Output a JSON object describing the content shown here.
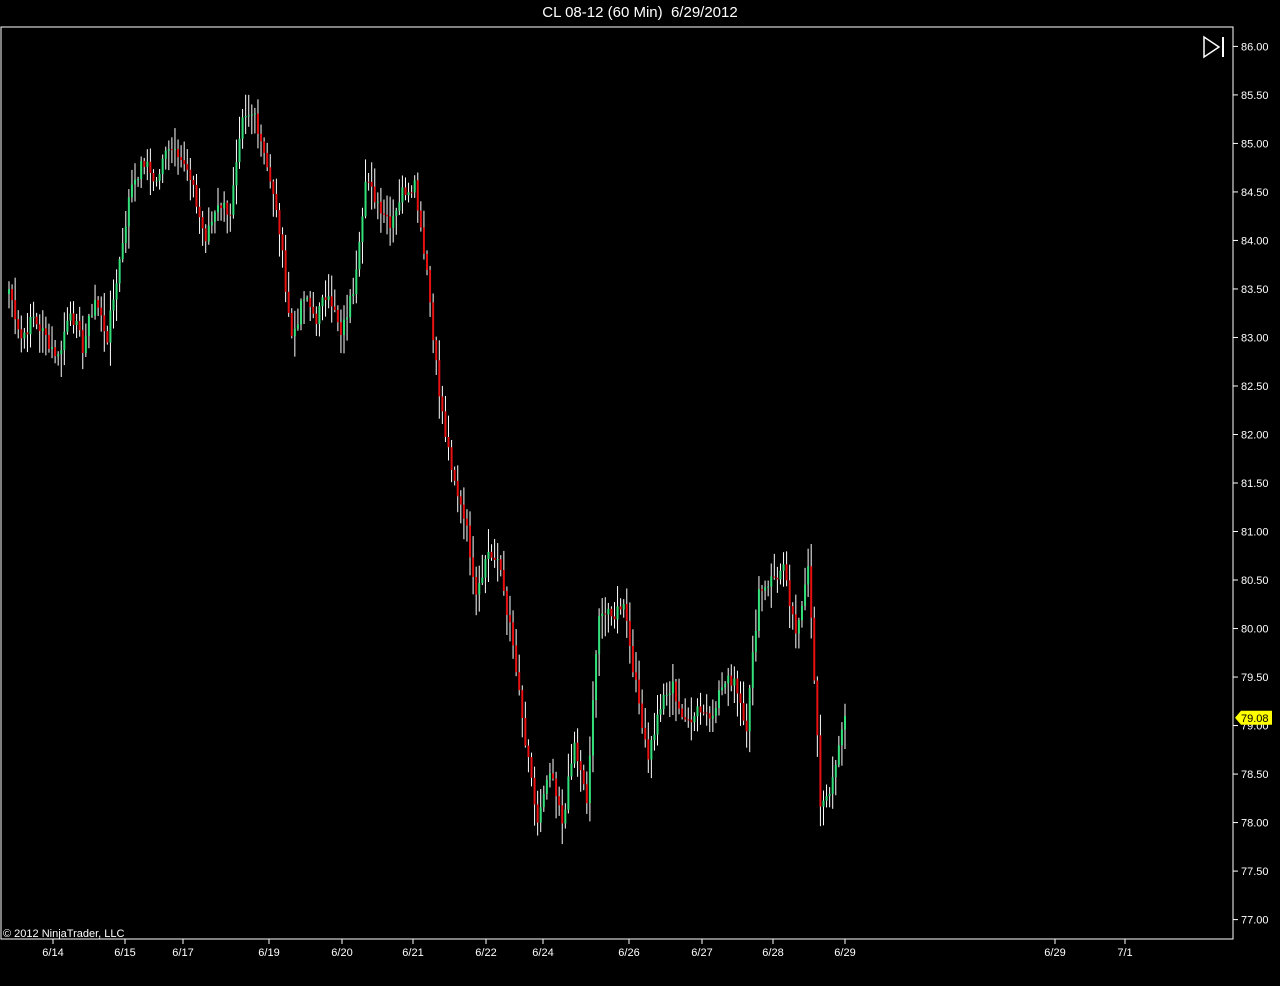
{
  "title": "CL 08-12 (60 Min)  6/29/2012",
  "copyright": "© 2012 NinjaTrader, LLC",
  "toolbar": {
    "icon": "play-to-end-icon"
  },
  "colors": {
    "background": "#000000",
    "up": "#33e07a",
    "down": "#e81010",
    "wick": "#ffffff",
    "frame": "#ffffff",
    "last_price_marker": "#ffff00"
  },
  "chart_data": {
    "type": "candlestick",
    "title": "CL 08-12 (60 Min)  6/29/2012",
    "xlabel": "",
    "ylabel": "",
    "ylim": [
      76.8,
      86.2
    ],
    "grid": false,
    "y_ticks": [
      "86.00",
      "85.50",
      "85.00",
      "84.50",
      "84.00",
      "83.50",
      "83.00",
      "82.50",
      "82.00",
      "81.50",
      "81.00",
      "80.50",
      "80.00",
      "79.50",
      "79.00",
      "78.50",
      "78.00",
      "77.50",
      "77.00"
    ],
    "x_tick_labels": [
      "6/14",
      "6/15",
      "6/17",
      "6/19",
      "6/20",
      "6/21",
      "6/22",
      "6/24",
      "6/26",
      "6/27",
      "6/28",
      "6/29",
      "6/29",
      "7/1"
    ],
    "last_price": "79.08",
    "anchor_prices": [
      83.5,
      83.0,
      83.2,
      83.0,
      82.8,
      83.3,
      82.9,
      83.4,
      83.0,
      83.8,
      84.6,
      84.8,
      84.6,
      85.0,
      84.9,
      84.5,
      84.0,
      84.4,
      84.3,
      85.2,
      85.3,
      84.8,
      84.1,
      83.0,
      83.4,
      83.2,
      83.5,
      83.0,
      83.5,
      84.6,
      84.4,
      84.2,
      84.5,
      84.6,
      83.7,
      82.4,
      81.6,
      81.2,
      80.4,
      80.8,
      80.6,
      79.8,
      78.8,
      78.0,
      78.5,
      78.0,
      78.8,
      78.2,
      80.2,
      80.1,
      80.3,
      79.4,
      78.7,
      79.2,
      79.4,
      79.0,
      79.2,
      79.1,
      79.4,
      79.5,
      79.0,
      80.4,
      80.5,
      80.6,
      79.9,
      80.7,
      78.2,
      78.4,
      79.1
    ]
  }
}
